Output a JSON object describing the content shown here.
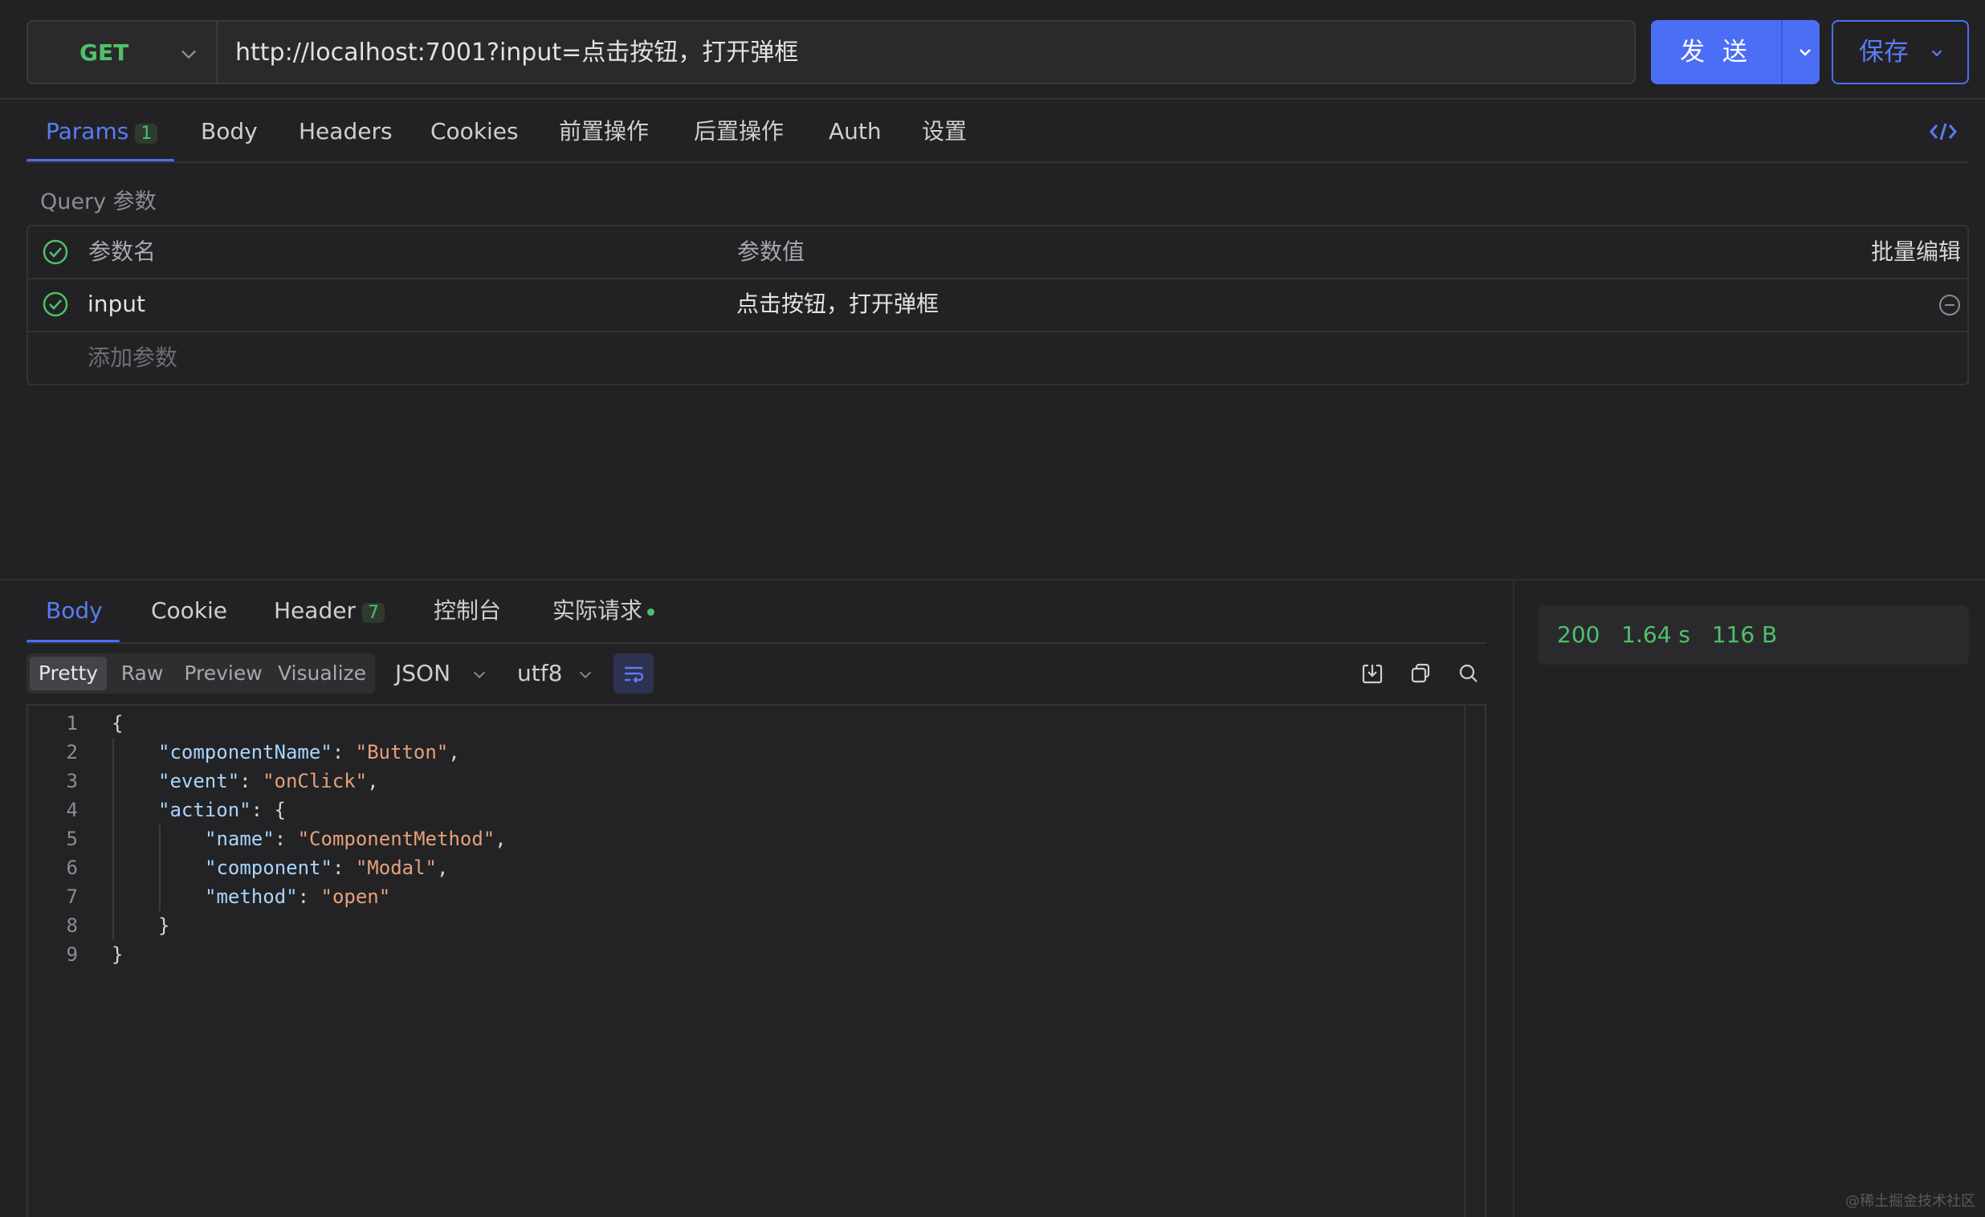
{
  "request": {
    "method": "GET",
    "url": "http://localhost:7001?input=点击按钮，打开弹框",
    "send_label": "发 送",
    "save_label": "保存"
  },
  "request_tabs": [
    {
      "label": "Params",
      "count": "1"
    },
    {
      "label": "Body"
    },
    {
      "label": "Headers"
    },
    {
      "label": "Cookies"
    },
    {
      "label": "前置操作"
    },
    {
      "label": "后置操作"
    },
    {
      "label": "Auth"
    },
    {
      "label": "设置"
    }
  ],
  "query": {
    "section_label": "Query 参数",
    "col_name": "参数名",
    "col_value": "参数值",
    "bulk_edit": "批量编辑",
    "rows": [
      {
        "name": "input",
        "value": "点击按钮，打开弹框",
        "enabled": true
      }
    ],
    "add_placeholder": "添加参数"
  },
  "response_tabs": [
    {
      "label": "Body"
    },
    {
      "label": "Cookie"
    },
    {
      "label": "Header",
      "count": "7"
    },
    {
      "label": "控制台"
    },
    {
      "label": "实际请求"
    }
  ],
  "view_modes": [
    "Pretty",
    "Raw",
    "Preview",
    "Visualize"
  ],
  "format": "JSON",
  "encoding": "utf8",
  "code_lines": [
    "1",
    "2",
    "3",
    "4",
    "5",
    "6",
    "7",
    "8",
    "9"
  ],
  "code": {
    "l1": "{",
    "l2_key": "\"componentName\"",
    "l2_val": "\"Button\"",
    "l3_key": "\"event\"",
    "l3_val": "\"onClick\"",
    "l4_key": "\"action\"",
    "l4_rest": ": {",
    "l5_key": "\"name\"",
    "l5_val": "\"ComponentMethod\"",
    "l6_key": "\"component\"",
    "l6_val": "\"Modal\"",
    "l7_key": "\"method\"",
    "l7_val": "\"open\"",
    "l8": "}",
    "l9": "}"
  },
  "status": {
    "code": "200",
    "time": "1.64 s",
    "size": "116 B",
    "color": "#4fc06a"
  },
  "colors": {
    "accent": "#4c6ef5",
    "success": "#4fc06a",
    "background": "#222224"
  },
  "watermark": "@稀土掘金技术社区"
}
